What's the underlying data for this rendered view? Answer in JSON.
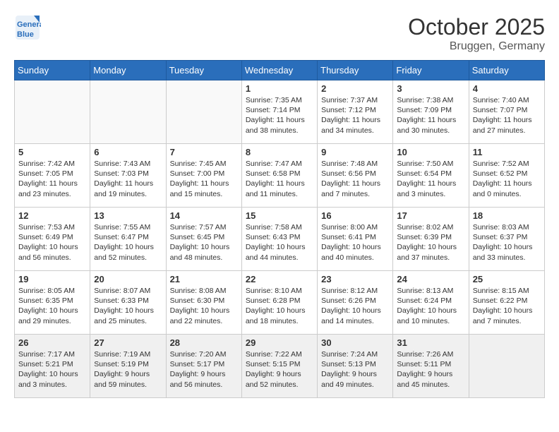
{
  "logo": {
    "line1": "General",
    "line2": "Blue"
  },
  "title": "October 2025",
  "location": "Bruggen, Germany",
  "days_of_week": [
    "Sunday",
    "Monday",
    "Tuesday",
    "Wednesday",
    "Thursday",
    "Friday",
    "Saturday"
  ],
  "weeks": [
    [
      {
        "day": "",
        "info": ""
      },
      {
        "day": "",
        "info": ""
      },
      {
        "day": "",
        "info": ""
      },
      {
        "day": "1",
        "info": "Sunrise: 7:35 AM\nSunset: 7:14 PM\nDaylight: 11 hours\nand 38 minutes."
      },
      {
        "day": "2",
        "info": "Sunrise: 7:37 AM\nSunset: 7:12 PM\nDaylight: 11 hours\nand 34 minutes."
      },
      {
        "day": "3",
        "info": "Sunrise: 7:38 AM\nSunset: 7:09 PM\nDaylight: 11 hours\nand 30 minutes."
      },
      {
        "day": "4",
        "info": "Sunrise: 7:40 AM\nSunset: 7:07 PM\nDaylight: 11 hours\nand 27 minutes."
      }
    ],
    [
      {
        "day": "5",
        "info": "Sunrise: 7:42 AM\nSunset: 7:05 PM\nDaylight: 11 hours\nand 23 minutes."
      },
      {
        "day": "6",
        "info": "Sunrise: 7:43 AM\nSunset: 7:03 PM\nDaylight: 11 hours\nand 19 minutes."
      },
      {
        "day": "7",
        "info": "Sunrise: 7:45 AM\nSunset: 7:00 PM\nDaylight: 11 hours\nand 15 minutes."
      },
      {
        "day": "8",
        "info": "Sunrise: 7:47 AM\nSunset: 6:58 PM\nDaylight: 11 hours\nand 11 minutes."
      },
      {
        "day": "9",
        "info": "Sunrise: 7:48 AM\nSunset: 6:56 PM\nDaylight: 11 hours\nand 7 minutes."
      },
      {
        "day": "10",
        "info": "Sunrise: 7:50 AM\nSunset: 6:54 PM\nDaylight: 11 hours\nand 3 minutes."
      },
      {
        "day": "11",
        "info": "Sunrise: 7:52 AM\nSunset: 6:52 PM\nDaylight: 11 hours\nand 0 minutes."
      }
    ],
    [
      {
        "day": "12",
        "info": "Sunrise: 7:53 AM\nSunset: 6:49 PM\nDaylight: 10 hours\nand 56 minutes."
      },
      {
        "day": "13",
        "info": "Sunrise: 7:55 AM\nSunset: 6:47 PM\nDaylight: 10 hours\nand 52 minutes."
      },
      {
        "day": "14",
        "info": "Sunrise: 7:57 AM\nSunset: 6:45 PM\nDaylight: 10 hours\nand 48 minutes."
      },
      {
        "day": "15",
        "info": "Sunrise: 7:58 AM\nSunset: 6:43 PM\nDaylight: 10 hours\nand 44 minutes."
      },
      {
        "day": "16",
        "info": "Sunrise: 8:00 AM\nSunset: 6:41 PM\nDaylight: 10 hours\nand 40 minutes."
      },
      {
        "day": "17",
        "info": "Sunrise: 8:02 AM\nSunset: 6:39 PM\nDaylight: 10 hours\nand 37 minutes."
      },
      {
        "day": "18",
        "info": "Sunrise: 8:03 AM\nSunset: 6:37 PM\nDaylight: 10 hours\nand 33 minutes."
      }
    ],
    [
      {
        "day": "19",
        "info": "Sunrise: 8:05 AM\nSunset: 6:35 PM\nDaylight: 10 hours\nand 29 minutes."
      },
      {
        "day": "20",
        "info": "Sunrise: 8:07 AM\nSunset: 6:33 PM\nDaylight: 10 hours\nand 25 minutes."
      },
      {
        "day": "21",
        "info": "Sunrise: 8:08 AM\nSunset: 6:30 PM\nDaylight: 10 hours\nand 22 minutes."
      },
      {
        "day": "22",
        "info": "Sunrise: 8:10 AM\nSunset: 6:28 PM\nDaylight: 10 hours\nand 18 minutes."
      },
      {
        "day": "23",
        "info": "Sunrise: 8:12 AM\nSunset: 6:26 PM\nDaylight: 10 hours\nand 14 minutes."
      },
      {
        "day": "24",
        "info": "Sunrise: 8:13 AM\nSunset: 6:24 PM\nDaylight: 10 hours\nand 10 minutes."
      },
      {
        "day": "25",
        "info": "Sunrise: 8:15 AM\nSunset: 6:22 PM\nDaylight: 10 hours\nand 7 minutes."
      }
    ],
    [
      {
        "day": "26",
        "info": "Sunrise: 7:17 AM\nSunset: 5:21 PM\nDaylight: 10 hours\nand 3 minutes."
      },
      {
        "day": "27",
        "info": "Sunrise: 7:19 AM\nSunset: 5:19 PM\nDaylight: 9 hours\nand 59 minutes."
      },
      {
        "day": "28",
        "info": "Sunrise: 7:20 AM\nSunset: 5:17 PM\nDaylight: 9 hours\nand 56 minutes."
      },
      {
        "day": "29",
        "info": "Sunrise: 7:22 AM\nSunset: 5:15 PM\nDaylight: 9 hours\nand 52 minutes."
      },
      {
        "day": "30",
        "info": "Sunrise: 7:24 AM\nSunset: 5:13 PM\nDaylight: 9 hours\nand 49 minutes."
      },
      {
        "day": "31",
        "info": "Sunrise: 7:26 AM\nSunset: 5:11 PM\nDaylight: 9 hours\nand 45 minutes."
      },
      {
        "day": "",
        "info": ""
      }
    ]
  ]
}
